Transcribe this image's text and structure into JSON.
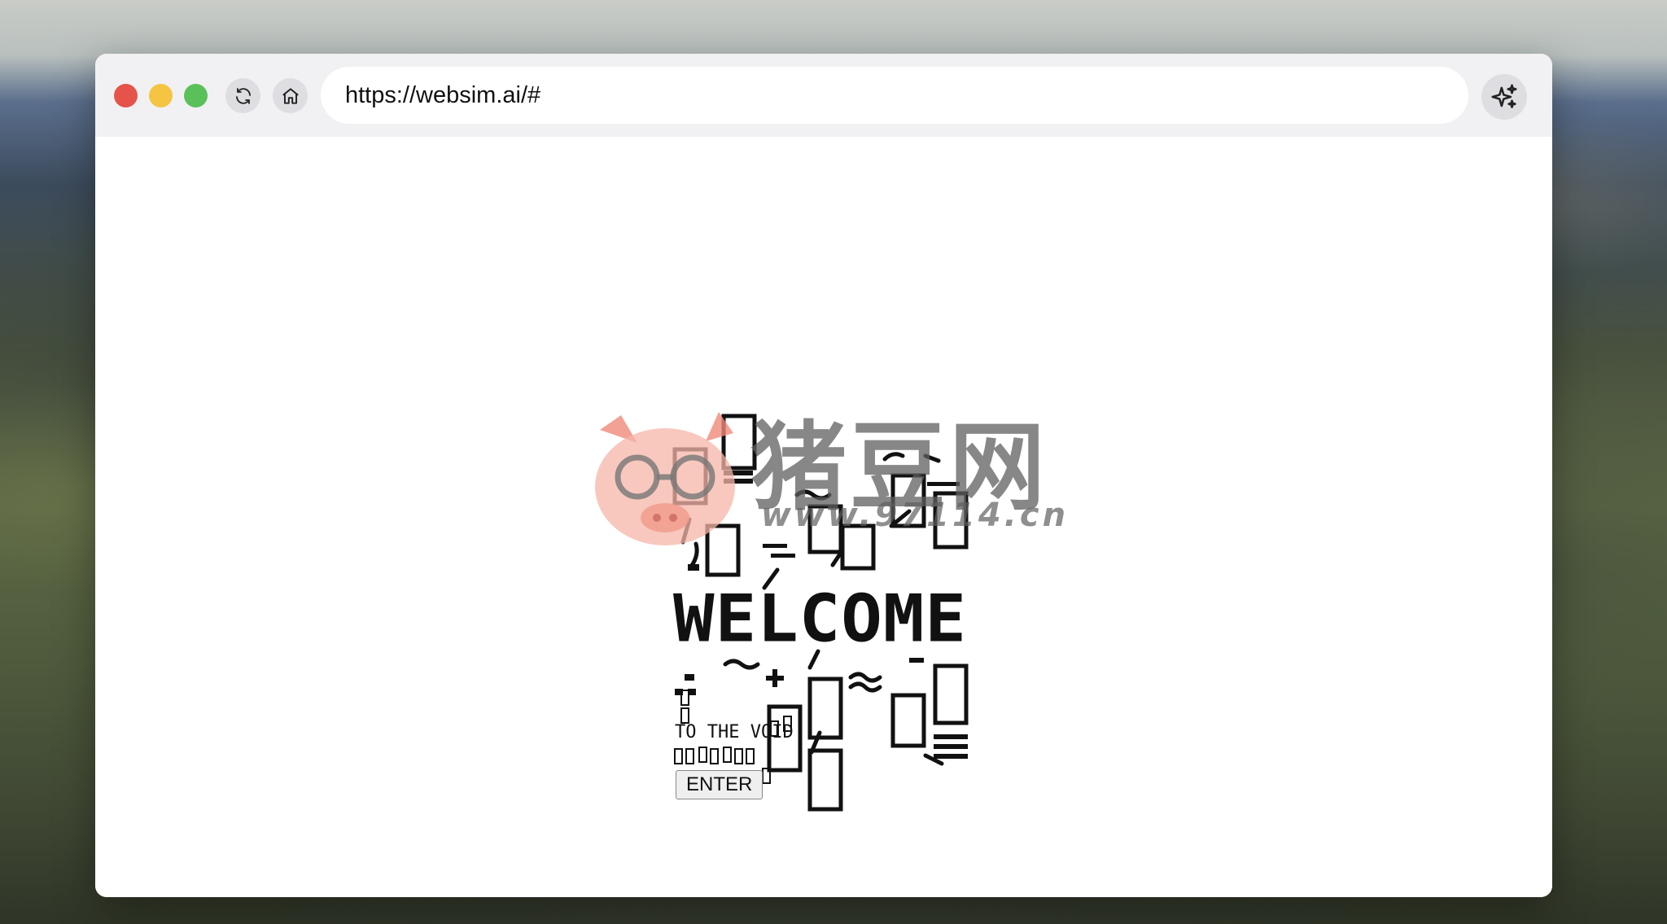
{
  "browser": {
    "url": "https://websim.ai/#",
    "reload_icon": "reload-icon",
    "home_icon": "home-icon",
    "sparkle_icon": "sparkle-icon"
  },
  "page": {
    "title": "WELCOME",
    "subtitle": "TO THE VOID",
    "enter_label": "ENTER"
  },
  "watermark": {
    "brand": "猪豆网",
    "url": "www.97114.cn"
  },
  "colors": {
    "close": "#e5534b",
    "minimize": "#f5c443",
    "maximize": "#5ac05a",
    "watermark_pig": "#f08a7a"
  }
}
